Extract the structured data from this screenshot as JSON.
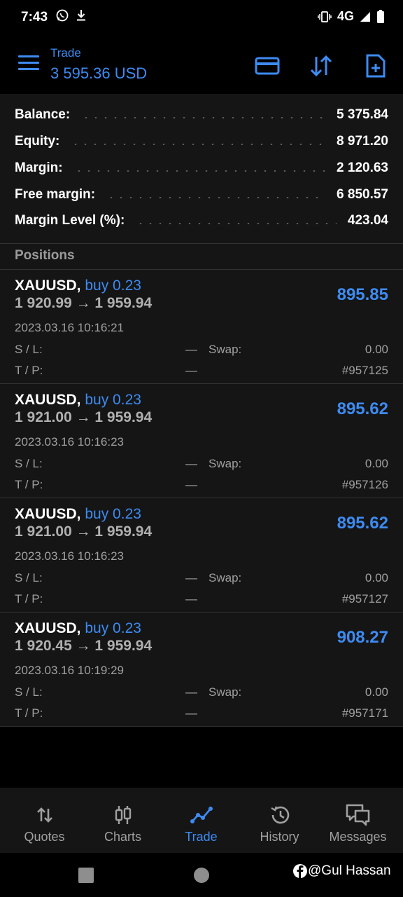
{
  "status_bar": {
    "time": "7:43",
    "network": "4G"
  },
  "header": {
    "title": "Trade",
    "balance_line": "3 595.36 USD"
  },
  "summary": [
    {
      "label": "Balance:",
      "value": "5 375.84"
    },
    {
      "label": "Equity:",
      "value": "8 971.20"
    },
    {
      "label": "Margin:",
      "value": "2 120.63"
    },
    {
      "label": "Free margin:",
      "value": "6 850.57"
    },
    {
      "label": "Margin Level (%):",
      "value": "423.04"
    }
  ],
  "positions_label": "Positions",
  "labels": {
    "sl": "S / L:",
    "tp": "T / P:",
    "swap": "Swap:"
  },
  "positions": [
    {
      "symbol": "XAUUSD,",
      "type": "buy 0.23",
      "prices": "1 920.99 → 1 959.94",
      "profit": "895.85",
      "time": "2023.03.16 10:16:21",
      "sl": "—",
      "tp": "—",
      "swap": "0.00",
      "ticket": "#957125"
    },
    {
      "symbol": "XAUUSD,",
      "type": "buy 0.23",
      "prices": "1 921.00 → 1 959.94",
      "profit": "895.62",
      "time": "2023.03.16 10:16:23",
      "sl": "—",
      "tp": "—",
      "swap": "0.00",
      "ticket": "#957126"
    },
    {
      "symbol": "XAUUSD,",
      "type": "buy 0.23",
      "prices": "1 921.00 → 1 959.94",
      "profit": "895.62",
      "time": "2023.03.16 10:16:23",
      "sl": "—",
      "tp": "—",
      "swap": "0.00",
      "ticket": "#957127"
    },
    {
      "symbol": "XAUUSD,",
      "type": "buy 0.23",
      "prices": "1 920.45 → 1 959.94",
      "profit": "908.27",
      "time": "2023.03.16 10:19:29",
      "sl": "—",
      "tp": "—",
      "swap": "0.00",
      "ticket": "#957171"
    }
  ],
  "nav": [
    {
      "label": "Quotes",
      "icon": "quotes-icon",
      "active": false
    },
    {
      "label": "Charts",
      "icon": "charts-icon",
      "active": false
    },
    {
      "label": "Trade",
      "icon": "trade-icon",
      "active": true
    },
    {
      "label": "History",
      "icon": "history-icon",
      "active": false
    },
    {
      "label": "Messages",
      "icon": "messages-icon",
      "active": false
    }
  ],
  "watermark": "@Gul Hassan",
  "colors": {
    "accent": "#3d8bf2",
    "panel": "#151515",
    "background": "#000000",
    "muted": "#a0a0a0"
  }
}
